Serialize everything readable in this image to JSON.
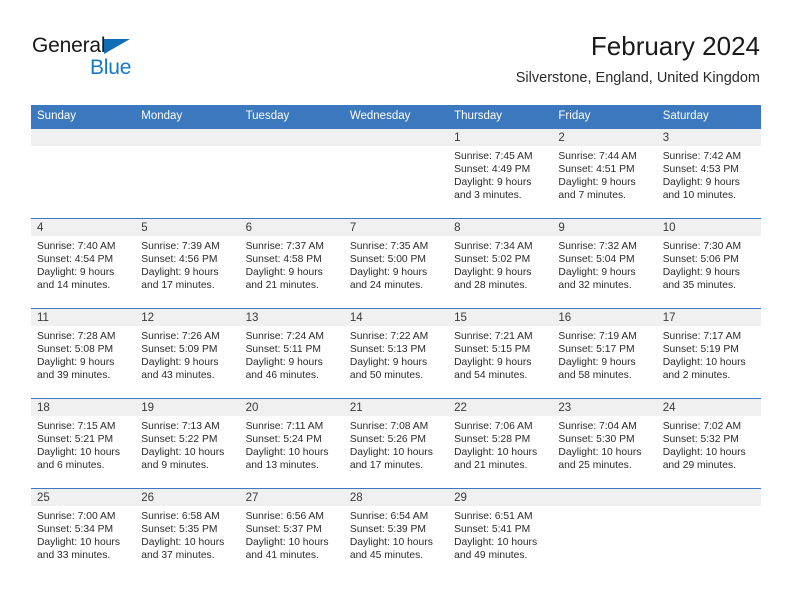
{
  "brand": {
    "name_part1": "General",
    "name_part2": "Blue",
    "logo_icon": "blue-triangle-flag-icon"
  },
  "header": {
    "title": "February 2024",
    "subtitle": "Silverstone, England, United Kingdom"
  },
  "colors": {
    "header_blue": "#3b78bd",
    "brand_blue": "#1878c8",
    "day_band_gray": "#f0f0f0",
    "text": "#2b2b2b"
  },
  "weekdays": [
    "Sunday",
    "Monday",
    "Tuesday",
    "Wednesday",
    "Thursday",
    "Friday",
    "Saturday"
  ],
  "labels": {
    "sunrise": "Sunrise:",
    "sunset": "Sunset:",
    "daylight": "Daylight:"
  },
  "weeks": [
    [
      {
        "day": "",
        "empty": true
      },
      {
        "day": "",
        "empty": true
      },
      {
        "day": "",
        "empty": true
      },
      {
        "day": "",
        "empty": true
      },
      {
        "day": "1",
        "sunrise": "Sunrise: 7:45 AM",
        "sunset": "Sunset: 4:49 PM",
        "daylight1": "Daylight: 9 hours",
        "daylight2": "and 3 minutes."
      },
      {
        "day": "2",
        "sunrise": "Sunrise: 7:44 AM",
        "sunset": "Sunset: 4:51 PM",
        "daylight1": "Daylight: 9 hours",
        "daylight2": "and 7 minutes."
      },
      {
        "day": "3",
        "sunrise": "Sunrise: 7:42 AM",
        "sunset": "Sunset: 4:53 PM",
        "daylight1": "Daylight: 9 hours",
        "daylight2": "and 10 minutes."
      }
    ],
    [
      {
        "day": "4",
        "sunrise": "Sunrise: 7:40 AM",
        "sunset": "Sunset: 4:54 PM",
        "daylight1": "Daylight: 9 hours",
        "daylight2": "and 14 minutes."
      },
      {
        "day": "5",
        "sunrise": "Sunrise: 7:39 AM",
        "sunset": "Sunset: 4:56 PM",
        "daylight1": "Daylight: 9 hours",
        "daylight2": "and 17 minutes."
      },
      {
        "day": "6",
        "sunrise": "Sunrise: 7:37 AM",
        "sunset": "Sunset: 4:58 PM",
        "daylight1": "Daylight: 9 hours",
        "daylight2": "and 21 minutes."
      },
      {
        "day": "7",
        "sunrise": "Sunrise: 7:35 AM",
        "sunset": "Sunset: 5:00 PM",
        "daylight1": "Daylight: 9 hours",
        "daylight2": "and 24 minutes."
      },
      {
        "day": "8",
        "sunrise": "Sunrise: 7:34 AM",
        "sunset": "Sunset: 5:02 PM",
        "daylight1": "Daylight: 9 hours",
        "daylight2": "and 28 minutes."
      },
      {
        "day": "9",
        "sunrise": "Sunrise: 7:32 AM",
        "sunset": "Sunset: 5:04 PM",
        "daylight1": "Daylight: 9 hours",
        "daylight2": "and 32 minutes."
      },
      {
        "day": "10",
        "sunrise": "Sunrise: 7:30 AM",
        "sunset": "Sunset: 5:06 PM",
        "daylight1": "Daylight: 9 hours",
        "daylight2": "and 35 minutes."
      }
    ],
    [
      {
        "day": "11",
        "sunrise": "Sunrise: 7:28 AM",
        "sunset": "Sunset: 5:08 PM",
        "daylight1": "Daylight: 9 hours",
        "daylight2": "and 39 minutes."
      },
      {
        "day": "12",
        "sunrise": "Sunrise: 7:26 AM",
        "sunset": "Sunset: 5:09 PM",
        "daylight1": "Daylight: 9 hours",
        "daylight2": "and 43 minutes."
      },
      {
        "day": "13",
        "sunrise": "Sunrise: 7:24 AM",
        "sunset": "Sunset: 5:11 PM",
        "daylight1": "Daylight: 9 hours",
        "daylight2": "and 46 minutes."
      },
      {
        "day": "14",
        "sunrise": "Sunrise: 7:22 AM",
        "sunset": "Sunset: 5:13 PM",
        "daylight1": "Daylight: 9 hours",
        "daylight2": "and 50 minutes."
      },
      {
        "day": "15",
        "sunrise": "Sunrise: 7:21 AM",
        "sunset": "Sunset: 5:15 PM",
        "daylight1": "Daylight: 9 hours",
        "daylight2": "and 54 minutes."
      },
      {
        "day": "16",
        "sunrise": "Sunrise: 7:19 AM",
        "sunset": "Sunset: 5:17 PM",
        "daylight1": "Daylight: 9 hours",
        "daylight2": "and 58 minutes."
      },
      {
        "day": "17",
        "sunrise": "Sunrise: 7:17 AM",
        "sunset": "Sunset: 5:19 PM",
        "daylight1": "Daylight: 10 hours",
        "daylight2": "and 2 minutes."
      }
    ],
    [
      {
        "day": "18",
        "sunrise": "Sunrise: 7:15 AM",
        "sunset": "Sunset: 5:21 PM",
        "daylight1": "Daylight: 10 hours",
        "daylight2": "and 6 minutes."
      },
      {
        "day": "19",
        "sunrise": "Sunrise: 7:13 AM",
        "sunset": "Sunset: 5:22 PM",
        "daylight1": "Daylight: 10 hours",
        "daylight2": "and 9 minutes."
      },
      {
        "day": "20",
        "sunrise": "Sunrise: 7:11 AM",
        "sunset": "Sunset: 5:24 PM",
        "daylight1": "Daylight: 10 hours",
        "daylight2": "and 13 minutes."
      },
      {
        "day": "21",
        "sunrise": "Sunrise: 7:08 AM",
        "sunset": "Sunset: 5:26 PM",
        "daylight1": "Daylight: 10 hours",
        "daylight2": "and 17 minutes."
      },
      {
        "day": "22",
        "sunrise": "Sunrise: 7:06 AM",
        "sunset": "Sunset: 5:28 PM",
        "daylight1": "Daylight: 10 hours",
        "daylight2": "and 21 minutes."
      },
      {
        "day": "23",
        "sunrise": "Sunrise: 7:04 AM",
        "sunset": "Sunset: 5:30 PM",
        "daylight1": "Daylight: 10 hours",
        "daylight2": "and 25 minutes."
      },
      {
        "day": "24",
        "sunrise": "Sunrise: 7:02 AM",
        "sunset": "Sunset: 5:32 PM",
        "daylight1": "Daylight: 10 hours",
        "daylight2": "and 29 minutes."
      }
    ],
    [
      {
        "day": "25",
        "sunrise": "Sunrise: 7:00 AM",
        "sunset": "Sunset: 5:34 PM",
        "daylight1": "Daylight: 10 hours",
        "daylight2": "and 33 minutes."
      },
      {
        "day": "26",
        "sunrise": "Sunrise: 6:58 AM",
        "sunset": "Sunset: 5:35 PM",
        "daylight1": "Daylight: 10 hours",
        "daylight2": "and 37 minutes."
      },
      {
        "day": "27",
        "sunrise": "Sunrise: 6:56 AM",
        "sunset": "Sunset: 5:37 PM",
        "daylight1": "Daylight: 10 hours",
        "daylight2": "and 41 minutes."
      },
      {
        "day": "28",
        "sunrise": "Sunrise: 6:54 AM",
        "sunset": "Sunset: 5:39 PM",
        "daylight1": "Daylight: 10 hours",
        "daylight2": "and 45 minutes."
      },
      {
        "day": "29",
        "sunrise": "Sunrise: 6:51 AM",
        "sunset": "Sunset: 5:41 PM",
        "daylight1": "Daylight: 10 hours",
        "daylight2": "and 49 minutes."
      },
      {
        "day": "",
        "empty": true
      },
      {
        "day": "",
        "empty": true
      }
    ]
  ]
}
